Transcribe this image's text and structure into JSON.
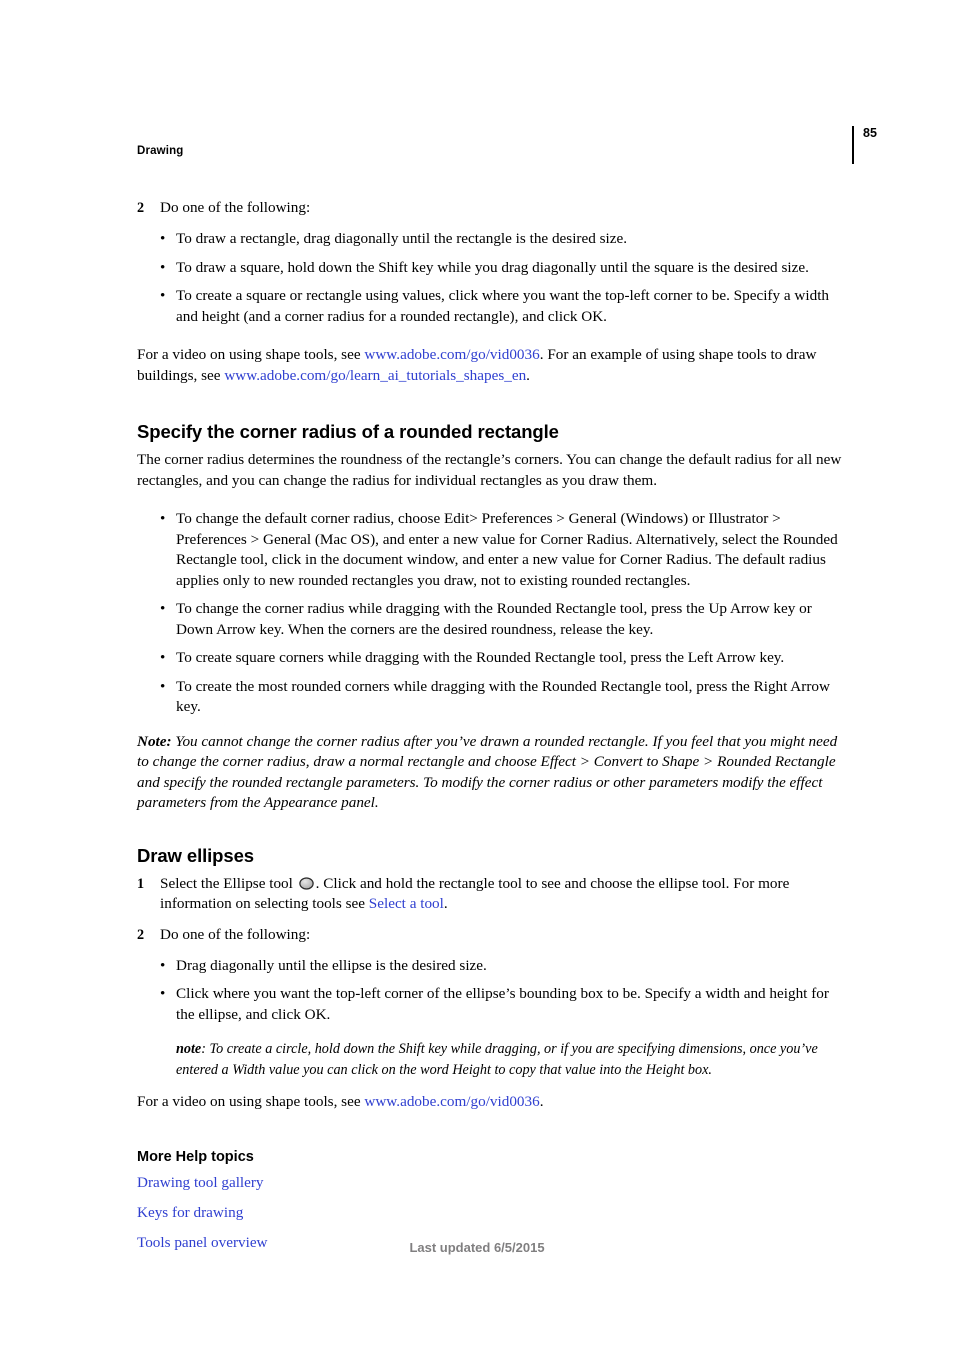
{
  "header": {
    "running_head": "Drawing",
    "page_number": "85"
  },
  "colors": {
    "link": "#2F3FD0",
    "text": "#000000",
    "footer": "#807F80"
  },
  "content": {
    "step_2_rect": {
      "number": "2",
      "text": "Do one of the following:"
    },
    "rect_bullets": [
      "To draw a rectangle, drag diagonally until the rectangle is the desired size.",
      "To draw a square, hold down the Shift key while you drag diagonally until the square is the desired size.",
      "To create a square or rectangle using values, click where you want the top-left corner to be. Specify a width and height (and a corner radius for a rounded rectangle), and click OK."
    ],
    "video_para_1": {
      "part1": "For a video on using shape tools, see ",
      "link1": "www.adobe.com/go/vid0036",
      "part2": ". For an example of using shape tools to draw buildings, see ",
      "link2": "www.adobe.com/go/learn_ai_tutorials_shapes_en",
      "part3": "."
    },
    "corner_radius_heading": "Specify the corner radius of a rounded rectangle",
    "corner_radius_intro": "The corner radius determines the roundness of the rectangle’s corners. You can change the default radius for all new rectangles, and you can change the radius for individual rectangles as you draw them.",
    "corner_radius_bullets": [
      "To change the default corner radius, choose Edit> Preferences > General (Windows) or Illustrator > Preferences > General (Mac OS), and enter a new value for Corner Radius. Alternatively, select the Rounded Rectangle tool, click in the document window, and enter a new value for Corner Radius. The default radius applies only to new rounded rectangles you draw, not to existing rounded rectangles.",
      "To change the corner radius while dragging with the Rounded Rectangle tool, press the Up Arrow key or Down Arrow key. When the corners are the desired roundness, release the key.",
      "To create square corners while dragging with the Rounded Rectangle tool, press the Left Arrow key.",
      "To create the most rounded corners while dragging with the Rounded Rectangle tool, press the Right Arrow key."
    ],
    "corner_radius_note": {
      "label": "Note:",
      "text": " You cannot change the corner radius after you’ve drawn a rounded rectangle. If you feel that you might need to change the corner radius, draw a normal rectangle and choose Effect > Convert to Shape > Rounded Rectangle and specify the rounded rectangle parameters. To modify the corner radius or other parameters modify the effect parameters from the Appearance panel."
    },
    "draw_ellipses_heading": "Draw ellipses",
    "step_1_ellipse": {
      "number": "1",
      "part1": "Select the Ellipse tool",
      "icon": "ellipse-tool-icon",
      "part2": ". Click and hold the rectangle tool to see and choose the ellipse tool. For more information on selecting tools see ",
      "link": "Select a tool",
      "part3": "."
    },
    "step_2_ellipse": {
      "number": "2",
      "text": "Do one of the following:"
    },
    "ellipse_bullets": [
      "Drag diagonally until the ellipse is the desired size.",
      "Click where you want the top-left corner of the ellipse’s bounding box to be. Specify a width and height for the ellipse, and click OK."
    ],
    "ellipse_subnote": {
      "label": "note",
      "text": ": To create a circle, hold down the Shift key while dragging, or if you are specifying dimensions, once you’ve entered a Width value you can click on the word Height to copy that value into the Height box."
    },
    "video_para_2": {
      "part1": "For a video on using shape tools, see ",
      "link1": "www.adobe.com/go/vid0036",
      "part2": "."
    },
    "more_help_heading": "More Help topics",
    "more_help_links": [
      "Drawing tool gallery",
      "Keys for drawing",
      "Tools panel overview"
    ]
  },
  "footer": {
    "text": "Last updated 6/5/2015"
  }
}
